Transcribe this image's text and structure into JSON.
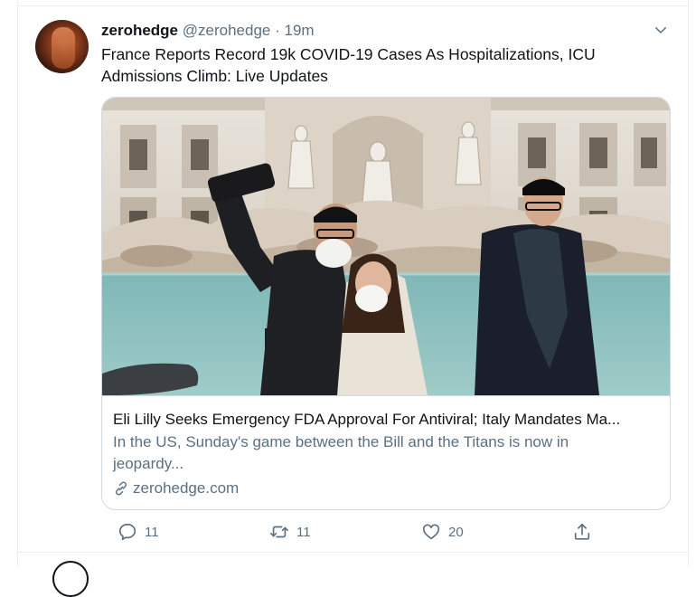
{
  "tweet": {
    "display_name": "zerohedge",
    "handle": "@zerohedge",
    "separator": "·",
    "time": "19m",
    "text": "France Reports Record 19k COVID-19 Cases As Hospitalizations, ICU Admissions Climb: Live Updates",
    "avatar_icon": "avatar-photo",
    "menu_icon": "chevron-down-icon"
  },
  "card": {
    "title": "Eli Lilly Seeks Emergency FDA Approval For Antiviral; Italy Mandates Ma...",
    "description": "In the US, Sunday's game between the Bill and the Titans is now in jeopardy...",
    "domain": "zerohedge.com",
    "domain_icon": "link-icon"
  },
  "actions": {
    "reply_count": "11",
    "retweet_count": "11",
    "like_count": "20",
    "share_icon": "share-icon"
  },
  "colors": {
    "secondary_text": "#5b7083",
    "border": "#cfd9de",
    "fountain_water": "#8fc3c2",
    "stone": "#d8cbbf"
  }
}
